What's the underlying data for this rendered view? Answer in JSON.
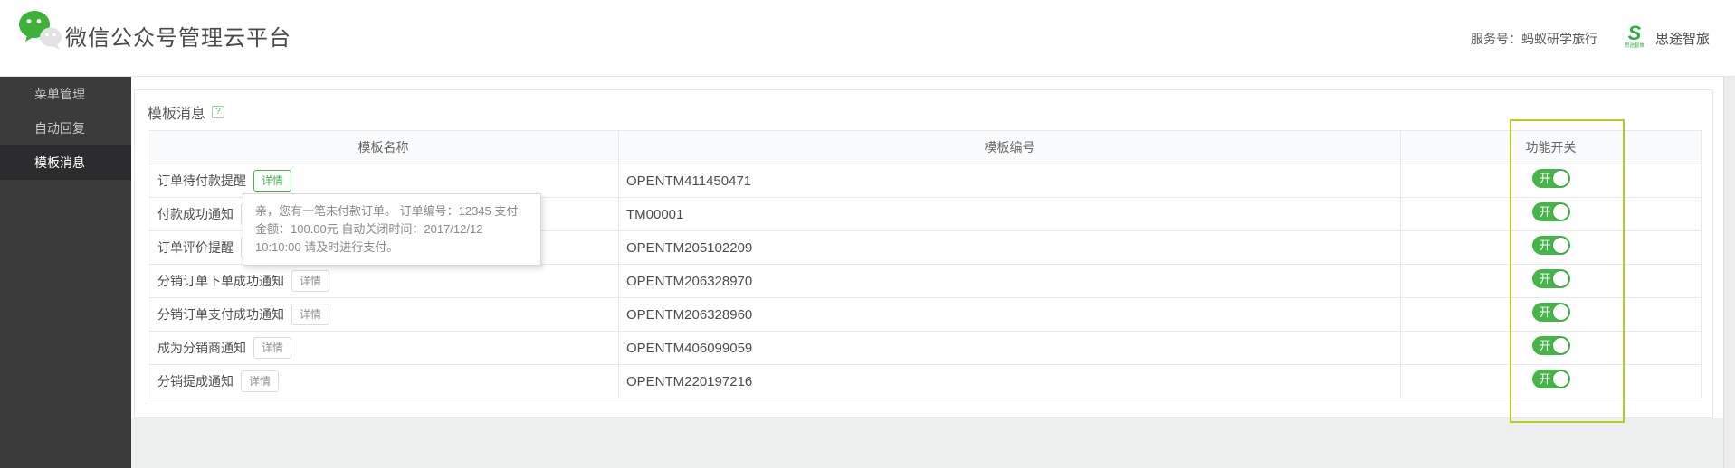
{
  "header": {
    "app_title": "微信公众号管理云平台",
    "service_account_label": "服务号：蚂蚁研学旅行",
    "brand_logo_letter": "S",
    "brand_logo_caption": "思途智旅",
    "brand_name": "思途智旅"
  },
  "sidebar": {
    "items": [
      {
        "label": "菜单管理",
        "active": false
      },
      {
        "label": "自动回复",
        "active": false
      },
      {
        "label": "模板消息",
        "active": true
      }
    ]
  },
  "main": {
    "page_title": "模板消息",
    "help_icon_glyph": "?",
    "table": {
      "headers": [
        "模板名称",
        "模板编号",
        "功能开关"
      ],
      "detail_button_label": "详情",
      "switch_on_label": "开",
      "rows": [
        {
          "name": "订单待付款提醒",
          "code": "OPENTM411450471",
          "switch": "开"
        },
        {
          "name": "付款成功通知",
          "code": "TM00001",
          "switch": "开"
        },
        {
          "name": "订单评价提醒",
          "code": "OPENTM205102209",
          "switch": "开"
        },
        {
          "name": "分销订单下单成功通知",
          "code": "OPENTM206328970",
          "switch": "开"
        },
        {
          "name": "分销订单支付成功通知",
          "code": "OPENTM206328960",
          "switch": "开"
        },
        {
          "name": "成为分销商通知",
          "code": "OPENTM406099059",
          "switch": "开"
        },
        {
          "name": "分销提成通知",
          "code": "OPENTM220197216",
          "switch": "开"
        }
      ]
    },
    "tooltip": {
      "text": "亲，您有一笔未付款订单。 订单编号：12345 支付金额：100.00元 自动关闭时间：2017/12/12 10:10:00 请及时进行支付。"
    }
  },
  "colors": {
    "accent_green": "#45b549",
    "annotation_yellow_green": "#b5cc1d",
    "sidebar_bg": "#3b3b3c"
  }
}
